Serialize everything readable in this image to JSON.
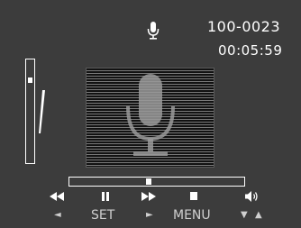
{
  "status": {
    "file_number": "100-0023",
    "elapsed_time": "00:05:59",
    "mode_icon": "microphone-icon"
  },
  "volume": {
    "level": 0.82
  },
  "playback": {
    "progress": 0.45
  },
  "controls": {
    "rewind_icon": "rewind-icon",
    "pause_icon": "pause-icon",
    "fast_forward_icon": "fast-forward-icon",
    "stop_icon": "stop-icon",
    "volume_icon": "speaker-icon",
    "left_arrow": "◄",
    "set_label": "SET",
    "right_arrow": "►",
    "menu_label": "MENU",
    "down_arrow": "▼",
    "up_arrow": "▲"
  },
  "colors": {
    "background": "#3c3c3c",
    "foreground": "#ffffff",
    "secondary": "#cfcfcf",
    "waveform_bg": "#121212"
  }
}
